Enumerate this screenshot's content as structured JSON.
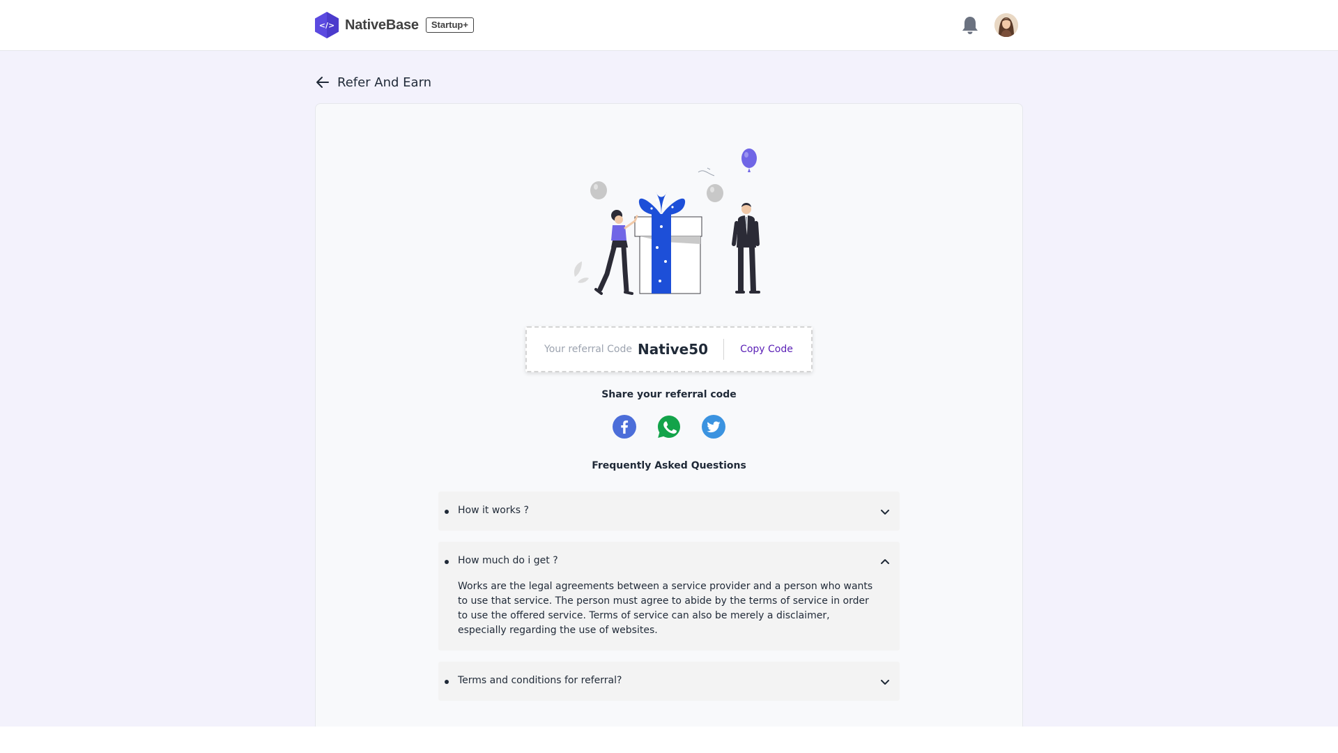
{
  "navbar": {
    "brand_name": "NativeBase",
    "brand_badge": "Startup+",
    "logo_glyph": "</>",
    "icons": [
      "bell-icon",
      "avatar"
    ],
    "brand_color": "#5b4ae0"
  },
  "page": {
    "title": "Refer And Earn",
    "back_icon": "arrow-left-icon"
  },
  "referral": {
    "label": "Your referral Code",
    "code": "Native50",
    "copy_label": "Copy Code"
  },
  "share": {
    "title": "Share your referral code",
    "channels": [
      {
        "name": "facebook",
        "icon": "facebook-icon",
        "color": "#4c6ed9"
      },
      {
        "name": "whatsapp",
        "icon": "whatsapp-icon",
        "color": "#13a34a"
      },
      {
        "name": "twitter",
        "icon": "twitter-icon",
        "color": "#3b93e0"
      }
    ]
  },
  "faq": {
    "title": "Frequently Asked Questions",
    "items": [
      {
        "question": "How it works ?",
        "expanded": false,
        "answer": ""
      },
      {
        "question": "How much do i get ?",
        "expanded": true,
        "answer": "Works are the legal agreements between a service provider and a person who wants to use that service. The person must agree to abide by the terms of service in order to use the offered service. Terms of service can also be merely a disclaimer, especially regarding the use of websites."
      },
      {
        "question": "Terms and conditions for referral?",
        "expanded": false,
        "answer": ""
      }
    ]
  },
  "colors": {
    "page_background": "#f3f2fc",
    "accent": "#5b21b6",
    "gift_blue": "#1d4fd8"
  }
}
